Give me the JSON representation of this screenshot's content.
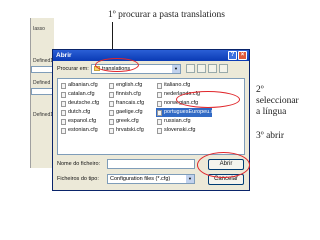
{
  "annotations": {
    "step1": "1º procurar a pasta translations",
    "step2_line1": "2º",
    "step2_line2": "seleccionar",
    "step2_line3": "a língua",
    "step3": "3º abrir"
  },
  "background_window": {
    "rows": [
      "Iasso",
      "Defined1]);",
      "Defined",
      "Defined1]);"
    ]
  },
  "dialog": {
    "title": "Abrir",
    "help_symbol": "?",
    "close_symbol": "×",
    "look_in_label": "Procurar em:",
    "look_in_value": "translations",
    "files": [
      [
        "albanian.cfg",
        "catalan.cfg",
        "deutsche.cfg",
        "dutch.cfg",
        "espanol.cfg",
        "estonian.cfg"
      ],
      [
        "english.cfg",
        "finnish.cfg",
        "francais.cfg",
        "gaelige.cfg",
        "greek.cfg",
        "hrvatski.cfg"
      ],
      [
        "italiano.cfg",
        "nederlands.cfg",
        "norwegian.cfg",
        "portuguesEuropeu.cfg",
        "russian.cfg",
        "slovenski.cfg"
      ],
      [
        "",
        "",
        "",
        "",
        "",
        ""
      ]
    ],
    "selected_file": "portuguesEuropeu.cfg",
    "filename_label": "Nome do ficheiro:",
    "filename_value": "",
    "filetype_label": "Ficheiros do tipo:",
    "filetype_value": "Configuration files (*.cfg)",
    "open_label": "Abrir",
    "cancel_label": "Cancelar"
  },
  "colors": {
    "highlight": "#e0262b",
    "titlebar": "#0a3ab4",
    "selection": "#316ac5"
  }
}
